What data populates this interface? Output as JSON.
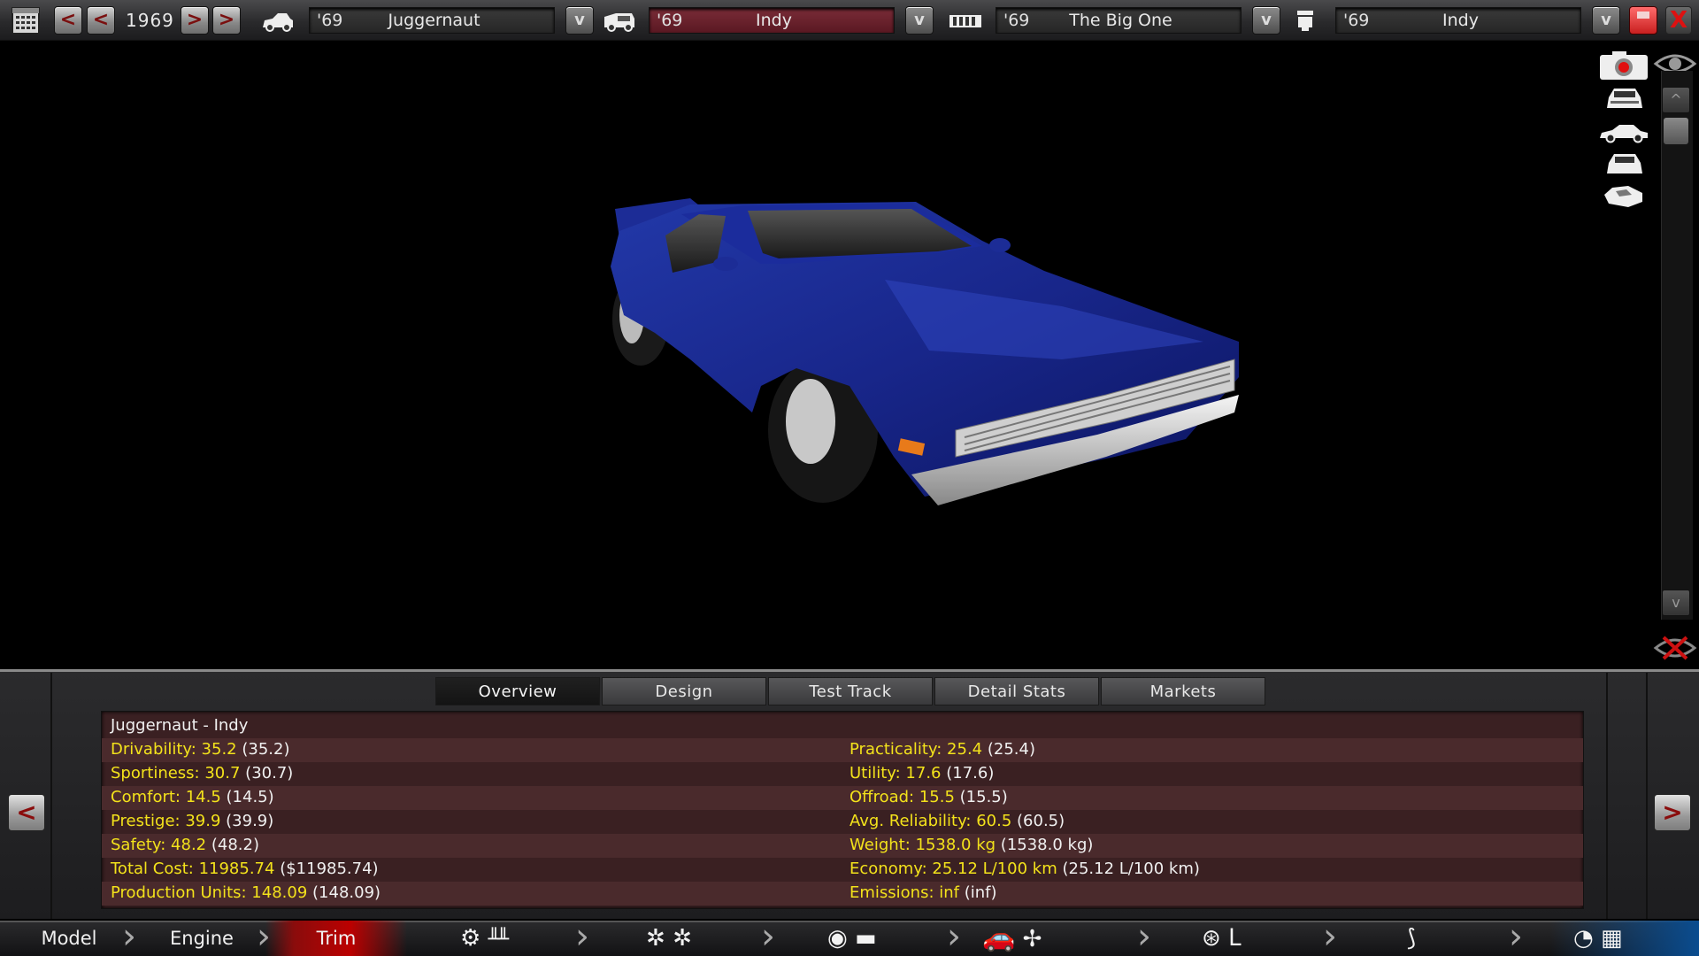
{
  "topbar": {
    "calendar_icon": "calendar-icon",
    "prev_fast": "<",
    "prev": "<",
    "year": "1969",
    "next": ">",
    "next_fast": ">",
    "model": {
      "year": "'69",
      "name": "Juggernaut"
    },
    "trim": {
      "year": "'69",
      "name": "Indy"
    },
    "engine": {
      "year": "'69",
      "name": "The Big One"
    },
    "engine_variant": {
      "year": "'69",
      "name": "Indy"
    },
    "dropdown": "v",
    "close": "X"
  },
  "view": {
    "scroll_up": "^",
    "scroll_down": "v",
    "icons": [
      "camera-icon",
      "eye-icon",
      "car-front-icon",
      "car-side-icon",
      "car-rear-icon",
      "car-top-icon",
      "hide-ui-icon"
    ],
    "car_color": "#1a2a8c"
  },
  "panel": {
    "tabs": [
      "Overview",
      "Design",
      "Test Track",
      "Detail Stats",
      "Markets"
    ],
    "active_tab": "Overview",
    "prev": "<",
    "next": ">",
    "title": "Juggernaut - Indy",
    "left_stats": [
      {
        "label": "Drivability: 35.2",
        "value": "(35.2)"
      },
      {
        "label": "Sportiness: 30.7",
        "value": "(30.7)"
      },
      {
        "label": "Comfort: 14.5",
        "value": "(14.5)"
      },
      {
        "label": "Prestige: 39.9",
        "value": "(39.9)"
      },
      {
        "label": "Safety: 48.2",
        "value": "(48.2)"
      },
      {
        "label": "Total Cost: 11985.74",
        "value": "($11985.74)"
      },
      {
        "label": "Production Units: 148.09",
        "value": "(148.09)"
      }
    ],
    "right_stats": [
      {
        "label": "Practicality: 25.4",
        "value": "(25.4)"
      },
      {
        "label": "Utility: 17.6",
        "value": "(17.6)"
      },
      {
        "label": "Offroad: 15.5",
        "value": "(15.5)"
      },
      {
        "label": "Avg. Reliability: 60.5",
        "value": "(60.5)"
      },
      {
        "label": "Weight: 1538.0 kg",
        "value": "(1538.0 kg)"
      },
      {
        "label": "Economy: 25.12 L/100 km",
        "value": "(25.12 L/100 km)"
      },
      {
        "label": "Emissions: inf",
        "value": "(inf)"
      }
    ]
  },
  "bottom_nav": {
    "model": "Model",
    "engine": "Engine",
    "trim": "Trim"
  }
}
